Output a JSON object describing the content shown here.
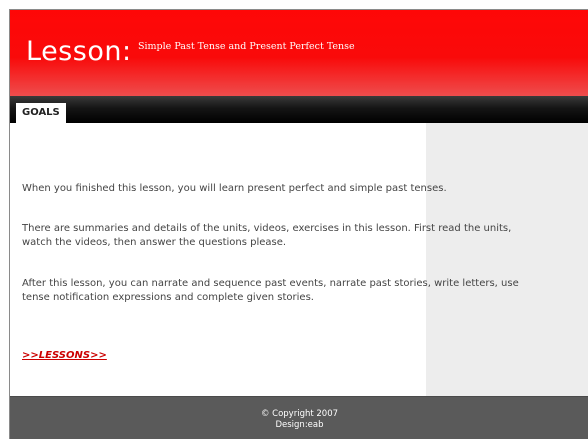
{
  "header": {
    "title": "Lesson:",
    "subtitle": "Simple Past Tense and Present Perfect Tense"
  },
  "nav": {
    "tab_goals": "GOALS"
  },
  "content": {
    "paragraph1": "When you finished this lesson, you will learn present perfect and simple past tenses.",
    "paragraph2_line1": "There are summaries and details of the units, videos, exercises in this lesson. First read the units,",
    "paragraph2_line2": "watch the videos, then answer the questions please.",
    "paragraph3_line1": "After this lesson, you can narrate and sequence past events, narrate past stories, write letters, use",
    "paragraph3_line2": "tense notification expressions and complete given stories.",
    "lessons_link": ">>LESSONS>>"
  },
  "footer": {
    "copyright": "© Copyright 2007",
    "design": "Design:eab"
  },
  "colors": {
    "header_red": "#ff0707",
    "nav_black": "#000000",
    "link_red": "#cc0000",
    "footer_gray": "#5a5a5a",
    "sidebar_gray": "#ededed"
  }
}
